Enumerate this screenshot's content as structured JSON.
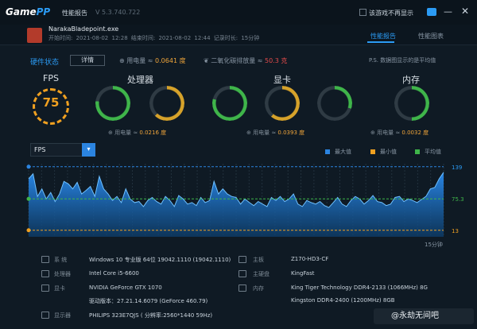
{
  "titlebar": {
    "logo_a": "Game",
    "logo_b": "PP",
    "title": "性能报告",
    "version": "V 5.3.740.722",
    "hide_checkbox_label": "该游戏不再显示"
  },
  "process": {
    "name": "NarakaBladepoint.exe",
    "dates": "开始时间: 2021-08-02 12:28   结束时间: 2021-08-02 12:44   记录时长: 15分钟"
  },
  "tabs": [
    "性能报告",
    "性能图表"
  ],
  "hardware": {
    "title": "硬件状态",
    "detail_button": "详情",
    "power_label": "用电量 ≈",
    "power_value": "0.0641 度",
    "co2_label": "二氧化碳排放量 ≈",
    "co2_value": "50.3 克",
    "ps": "P.S. 数据图显示的是平均值"
  },
  "fps": {
    "label": "FPS",
    "value": "75"
  },
  "cpu": {
    "title": "处理器",
    "usage": "77%",
    "usage_sub": "占用率",
    "usage_pct": 77,
    "temp": "62℃",
    "temp_sub": "温度",
    "temp_pct": 62,
    "power_label": "用电量 ≈",
    "power_value": "0.0216 度"
  },
  "gpu": {
    "title": "显卡",
    "usage": "79%",
    "usage_sub": "占用率",
    "usage_pct": 79,
    "temp": "61℃",
    "temp_sub": "温度",
    "temp_pct": 61,
    "vram": "30%",
    "vram_sub": "2.4/8 GB",
    "vram_pct": 30,
    "power_label": "用电量 ≈",
    "power_value": "0.0393 度"
  },
  "mem": {
    "title": "内存",
    "usage": "50%",
    "usage_sub": "8/16 GB",
    "usage_pct": 50,
    "power_label": "用电量 ≈",
    "power_value": "0.0032 度"
  },
  "chart": {
    "selector": "FPS",
    "legend": [
      "最大值",
      "最小值",
      "平均值"
    ],
    "max_label": "139",
    "avg_label": "75.3",
    "min_label": "13",
    "x_end_label": "15分钟"
  },
  "chart_data": {
    "type": "area",
    "ylim": [
      0,
      145
    ],
    "max": 139,
    "min": 13,
    "avg": 75.3,
    "xlabel": "15分钟",
    "values": [
      115,
      125,
      80,
      95,
      75,
      88,
      70,
      85,
      110,
      105,
      95,
      108,
      85,
      92,
      100,
      80,
      120,
      95,
      85,
      72,
      80,
      68,
      95,
      75,
      68,
      70,
      60,
      72,
      78,
      70,
      65,
      80,
      72,
      60,
      82,
      75,
      65,
      68,
      62,
      78,
      68,
      72,
      110,
      85,
      95,
      85,
      80,
      78,
      65,
      75,
      68,
      62,
      70,
      65,
      60,
      78,
      72,
      80,
      70,
      75,
      85,
      65,
      60,
      72,
      68,
      65,
      70,
      62,
      58,
      68,
      78,
      65,
      60,
      72,
      80,
      75,
      65,
      72,
      82,
      70,
      68,
      62,
      65,
      78,
      80,
      70,
      75,
      72,
      68,
      74,
      80,
      95,
      98,
      115,
      128
    ]
  },
  "system": {
    "os_label": "系 统",
    "os_value": "Windows 10 专业版 64位  19042.1110 (19042.1110)",
    "cpu_label": "处理器",
    "cpu_value": "Intel Core i5-6600",
    "gpu_label": "显卡",
    "gpu_value": "NVIDIA GeForce GTX 1070",
    "driver_value": "驱动版本：27.21.14.6079 (GeForce 460.79)",
    "monitor_label": "显示器",
    "monitor_value": "PHILIPS 323E7QJS ( 分辨率:2560*1440 59Hz)",
    "board_label": "主板",
    "board_value": "Z170-HD3-CF",
    "disk_label": "主硬盘",
    "disk_value": "KingFast",
    "mem_label": "内存",
    "mem_value1": "King Tiger Technology DDR4-2133 (1066MHz) 8G",
    "mem_value2": "Kingston DDR4-2400 (1200MHz) 8GB"
  },
  "watermark": "@永劫无间吧",
  "colors": {
    "accent": "#2b9bf4",
    "fps": "#f0a020",
    "ring_bg": "#2f3b44",
    "good": "#3fb54a",
    "warn": "#d6a22a"
  }
}
